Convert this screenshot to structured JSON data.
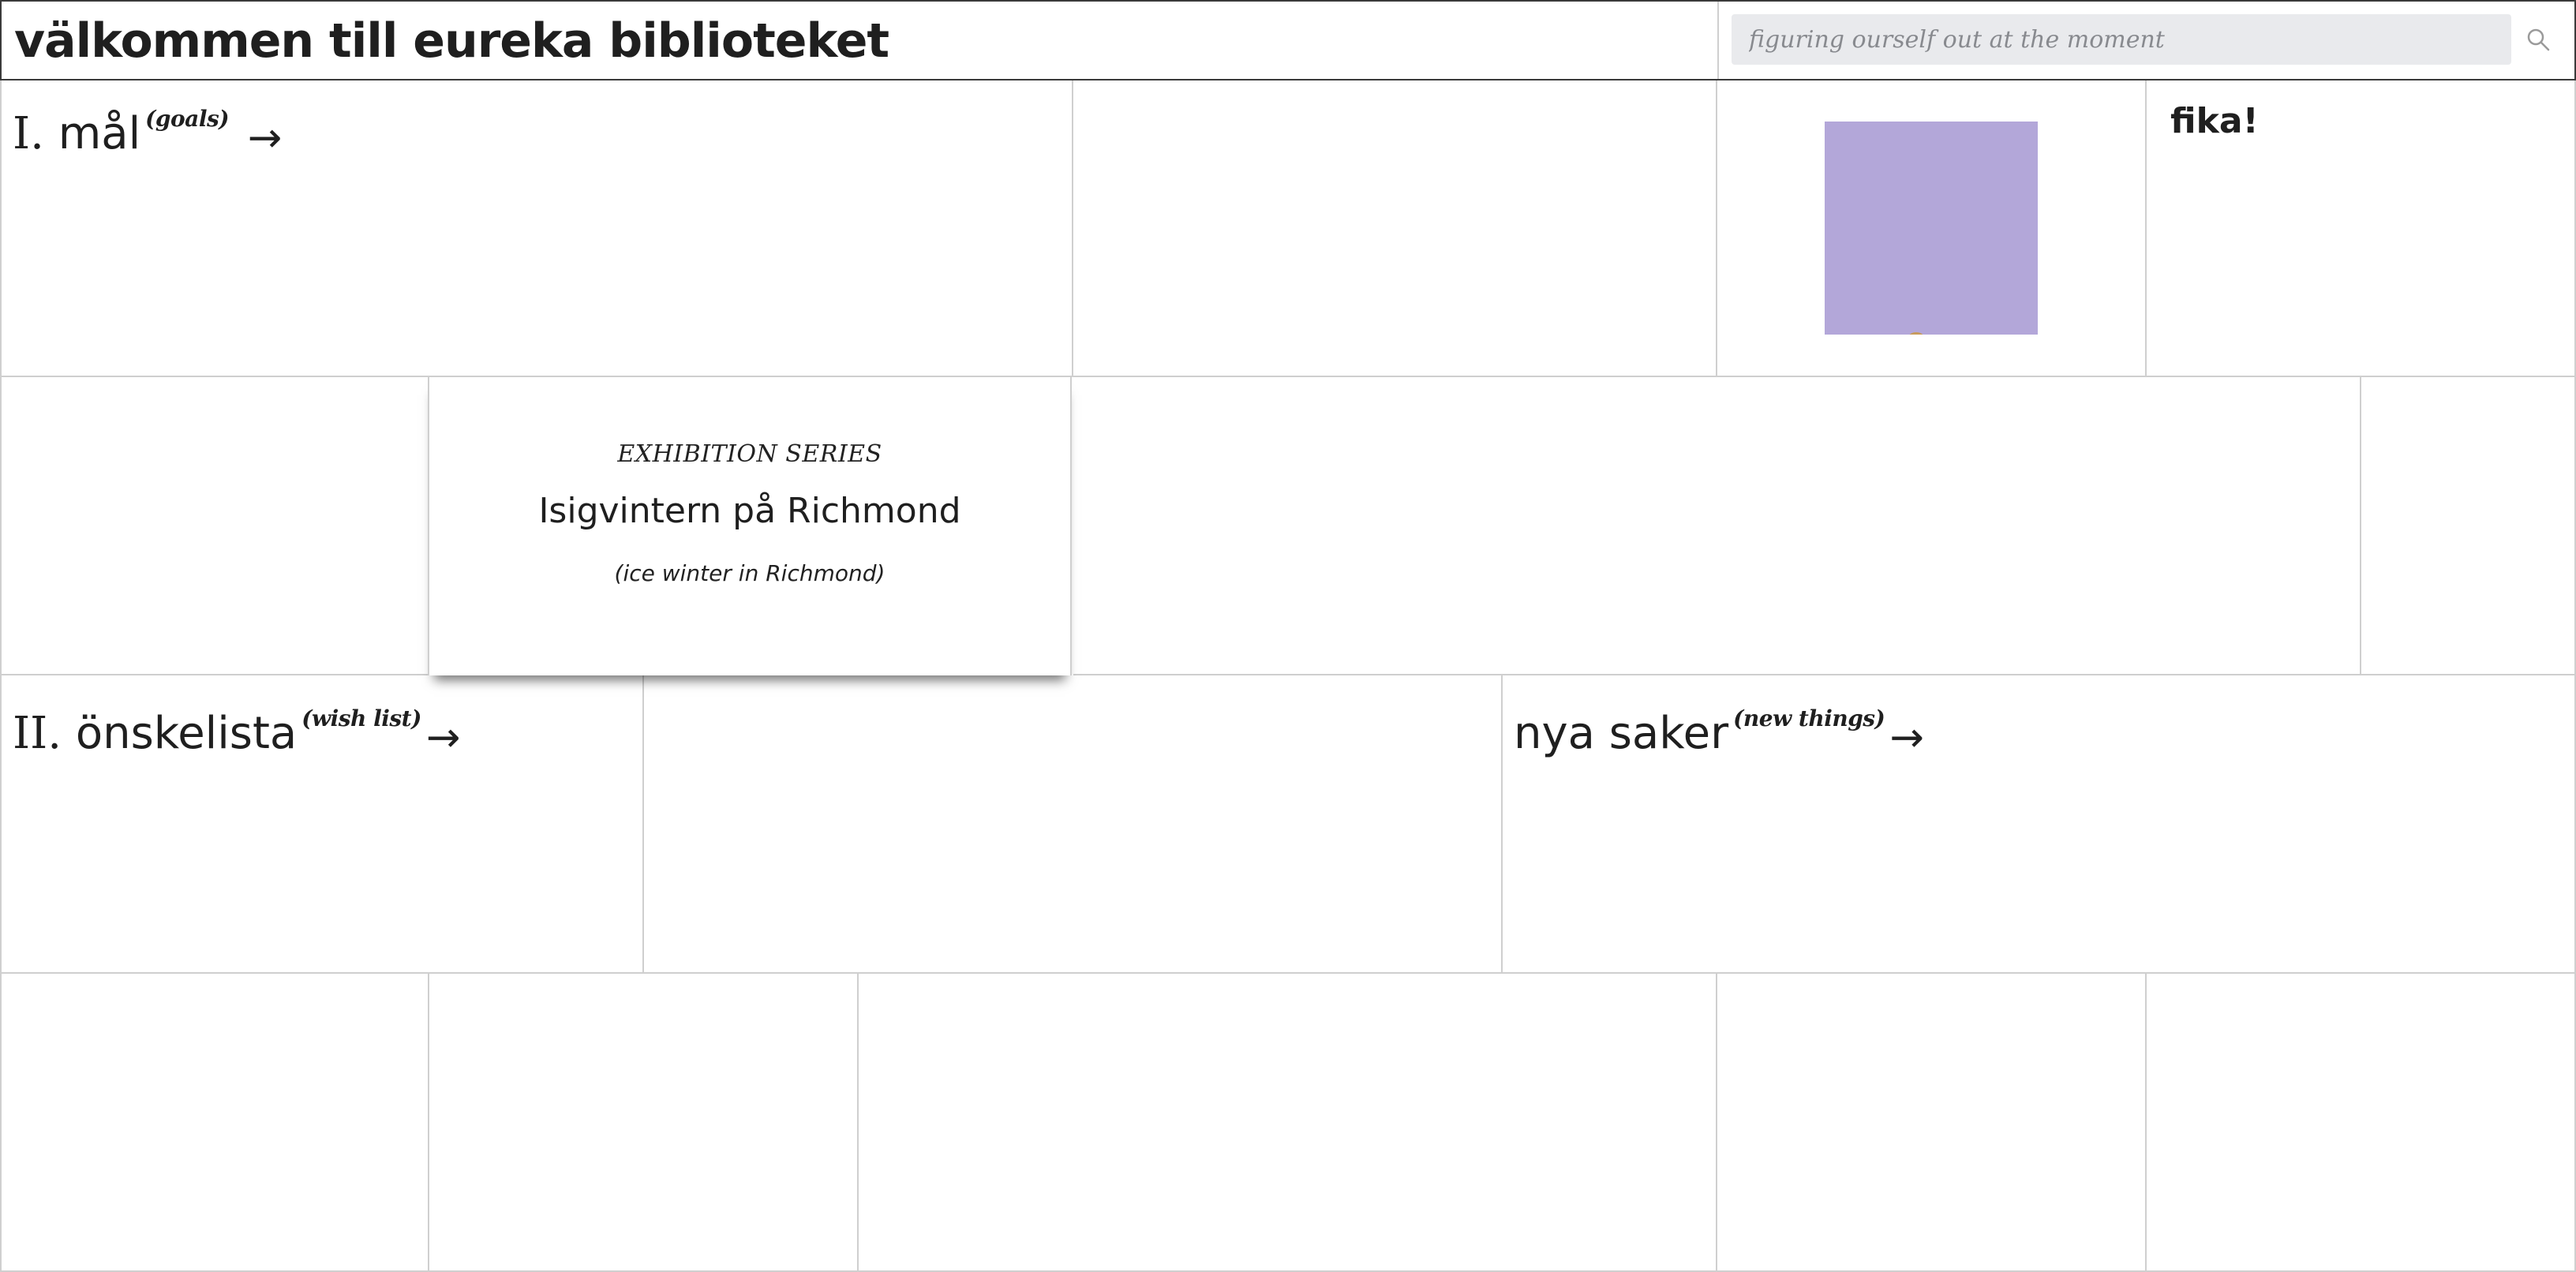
{
  "header": {
    "title": "välkommen till eureka biblioteket",
    "search": {
      "placeholder": "figuring ourself out at the moment",
      "value": ""
    }
  },
  "sections": {
    "goals": {
      "numeral": "I.",
      "title": "mål",
      "subtitle": "(goals)",
      "arrow": "→"
    },
    "wishlist": {
      "numeral": "II.",
      "title": "önskelista",
      "subtitle": "(wish list)",
      "arrow": "→"
    },
    "new_things": {
      "title": "nya saker",
      "subtitle": "(new things)",
      "arrow": "→"
    },
    "fika": {
      "title": "fika!"
    }
  },
  "exhibition": {
    "kicker": "EXHIBITION SERIES",
    "title": "Isigvintern på Richmond",
    "subtitle": "(ice winter in Richmond)"
  },
  "colors": {
    "cover_tile": "#b3a7d9",
    "grid_line": "#cfcfcf",
    "search_bg": "#e9eaed"
  }
}
